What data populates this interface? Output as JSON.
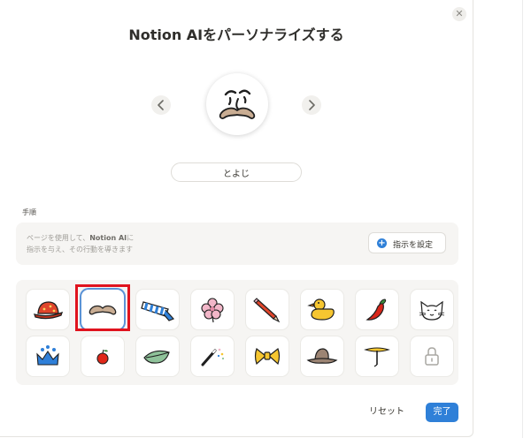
{
  "dialog": {
    "title": "Notion AIをパーソナライズする",
    "close_icon": "close-icon"
  },
  "avatar": {
    "name_value": "とよじ",
    "prev_icon": "chevron-left-icon",
    "next_icon": "chevron-right-icon",
    "face_icon": "mustache-face-icon"
  },
  "instructions": {
    "label": "手順",
    "placeholder_line1_pre": "ページを使用して、",
    "placeholder_line1_bold": "Notion AI",
    "placeholder_line1_post": "に",
    "placeholder_line2": "指示を与え、その行動を導きます",
    "set_button_label": "指示を設定"
  },
  "accessories": {
    "selected_index": 1,
    "items": [
      {
        "icon": "red-hat-icon"
      },
      {
        "icon": "mustache-icon"
      },
      {
        "icon": "striped-scarf-icon"
      },
      {
        "icon": "pink-flower-icon"
      },
      {
        "icon": "red-pencil-icon"
      },
      {
        "icon": "rubber-duck-icon"
      },
      {
        "icon": "chili-pepper-icon"
      },
      {
        "icon": "cat-face-icon"
      },
      {
        "icon": "blue-crown-icon"
      },
      {
        "icon": "apple-icon"
      },
      {
        "icon": "leaf-icon"
      },
      {
        "icon": "magic-wand-icon"
      },
      {
        "icon": "bow-tie-icon"
      },
      {
        "icon": "brown-hat-icon"
      },
      {
        "icon": "propeller-icon"
      },
      {
        "icon": "lock-icon"
      }
    ]
  },
  "footer": {
    "reset_label": "リセット",
    "done_label": "完了"
  },
  "colors": {
    "accent": "#2f80d8",
    "highlight": "#e0131e"
  }
}
